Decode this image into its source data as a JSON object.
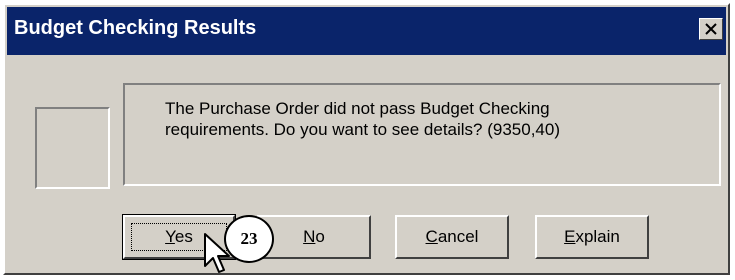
{
  "window": {
    "title": "Budget Checking Results",
    "close_icon": "close-icon"
  },
  "message": {
    "line1": "The Purchase Order did not pass Budget Checking",
    "line2": "requirements. Do you want to see details? (9350,40)"
  },
  "buttons": {
    "yes": {
      "mnemonic": "Y",
      "rest": "es"
    },
    "no": {
      "mnemonic": "N",
      "rest": "o"
    },
    "cancel": {
      "mnemonic": "C",
      "rest": "ancel"
    },
    "explain": {
      "mnemonic": "E",
      "rest": "xplain"
    }
  },
  "annotation": {
    "step_number": "23"
  },
  "colors": {
    "titlebar": "#0a246a",
    "dialog_face": "#d4d0c8"
  }
}
